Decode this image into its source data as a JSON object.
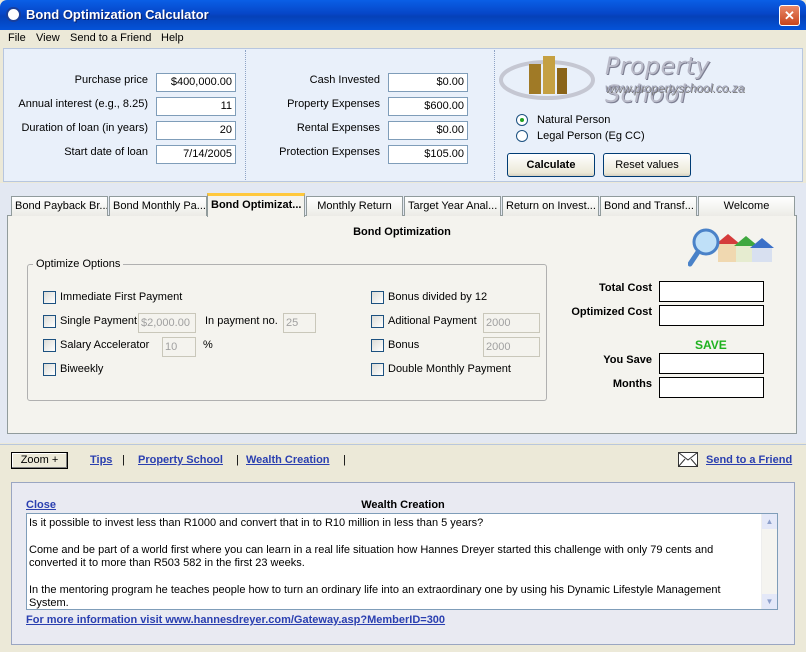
{
  "window": {
    "title": "Bond Optimization Calculator",
    "close_glyph": "✕"
  },
  "menu": [
    "File",
    "View",
    "Send to a Friend",
    "Help"
  ],
  "inputs_left": [
    {
      "label": "Purchase price",
      "value": "$400,000.00"
    },
    {
      "label": "Annual interest (e.g., 8.25)",
      "value": "11"
    },
    {
      "label": "Duration of loan (in years)",
      "value": "20"
    },
    {
      "label": "Start date of loan",
      "value": "7/14/2005"
    }
  ],
  "inputs_mid": [
    {
      "label": "Cash Invested",
      "value": "$0.00"
    },
    {
      "label": "Property Expenses",
      "value": "$600.00"
    },
    {
      "label": "Rental Expenses",
      "value": "$0.00"
    },
    {
      "label": "Protection Expenses",
      "value": "$105.00"
    }
  ],
  "logo": {
    "name": "Property School",
    "url": "www.propertyschool.co.za"
  },
  "person_type": [
    {
      "label": "Natural Person",
      "selected": true
    },
    {
      "label": "Legal Person (Eg CC)",
      "selected": false
    }
  ],
  "buttons": {
    "calculate": "Calculate",
    "reset": "Reset values"
  },
  "tabs": [
    {
      "label": "Bond Payback Br...",
      "active": false
    },
    {
      "label": "Bond Monthly Pa...",
      "active": false
    },
    {
      "label": "Bond Optimizat...",
      "active": true
    },
    {
      "label": "Monthly Return",
      "active": false
    },
    {
      "label": "Target Year Anal...",
      "active": false
    },
    {
      "label": "Return on Invest...",
      "active": false
    },
    {
      "label": "Bond and Transf...",
      "active": false
    },
    {
      "label": "Welcome",
      "active": false
    }
  ],
  "optimization": {
    "title": "Bond Optimization",
    "group_label": "Optimize Options",
    "left_options": {
      "immediate_first_payment": "Immediate First Payment",
      "single_payment": "Single Payment",
      "single_payment_amount": "$2,000.00",
      "in_payment_no_label": "In payment no.",
      "in_payment_no_value": "25",
      "salary_accelerator": "Salary Accelerator",
      "salary_accelerator_value": "10",
      "percent_sign": "%",
      "biweekly": "Biweekly"
    },
    "right_options": {
      "bonus_divided": "Bonus divided by 12",
      "aditional_payment": "Aditional Payment",
      "aditional_payment_value": "2000",
      "bonus": "Bonus",
      "bonus_value": "2000",
      "double_monthly": "Double Monthly Payment"
    },
    "results": {
      "total_cost": "Total Cost",
      "optimized_cost": "Optimized Cost",
      "save_heading": "SAVE",
      "you_save": "You Save",
      "months": "Months"
    }
  },
  "links_bar": {
    "zoom": "Zoom +",
    "tips": "Tips",
    "sep": "|",
    "property_school": "Property School",
    "wealth_creation": "Wealth Creation",
    "send_to_friend": "Send to a Friend"
  },
  "wealth_panel": {
    "close": "Close",
    "title": "Wealth Creation",
    "paragraphs": [
      "Is it possible to invest less than R1000 and convert that in to R10 million in less than 5 years?",
      "Come and be part of a world first where you can learn in a real life situation how Hannes Dreyer started this challenge with only 79 cents and converted it to more than R503 582  in the first 23 weeks.",
      "In the mentoring program he teaches people how to turn an ordinary life into an extraordinary one by using his Dynamic Lifestyle Management System."
    ],
    "footer_link": "For more information visit www.hannesdreyer.com/Gateway.asp?MemberID=300"
  },
  "colors": {
    "title_bar": "#0a5fe6",
    "link": "#2a3fb0",
    "save": "#1fb21f",
    "active_tab_accent": "#ffc83c"
  }
}
